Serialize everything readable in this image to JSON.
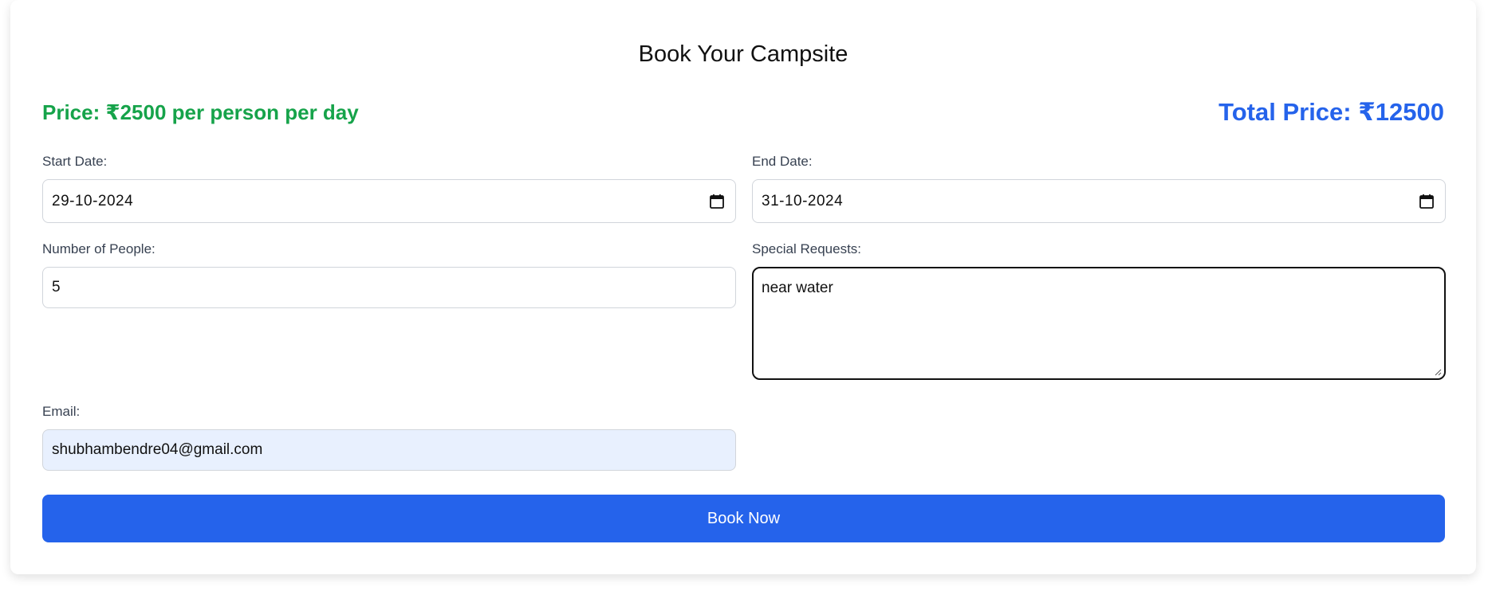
{
  "form": {
    "title": "Book Your Campsite",
    "price_text": "Price: ₹2500 per person per day",
    "total_text": "Total Price: ₹12500",
    "start_date_label": "Start Date:",
    "start_date_value": "29-10-2024",
    "end_date_label": "End Date:",
    "end_date_value": "31-10-2024",
    "people_label": "Number of People:",
    "people_value": "5",
    "requests_label": "Special Requests:",
    "requests_value": "near water",
    "email_label": "Email:",
    "email_value": "shubhambendre04@gmail.com",
    "submit_label": "Book Now"
  },
  "icons": {
    "date_picker": "calendar-icon"
  },
  "colors": {
    "price": "#16a34a",
    "total": "#2563eb",
    "button": "#2563eb",
    "email_autofill_bg": "#e8f0fe"
  }
}
